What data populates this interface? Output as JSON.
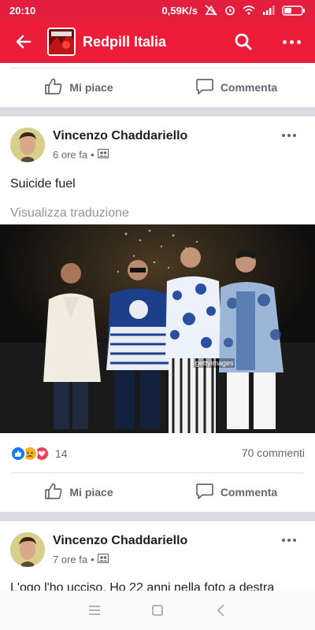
{
  "status_bar": {
    "time": "20:10",
    "speed": "0,59K/s",
    "icons": [
      "data-saver-icon",
      "alarm-icon",
      "wifi-icon",
      "signal-icon",
      "battery-icon"
    ]
  },
  "app_bar": {
    "title": "Redpill Italia",
    "icons": [
      "back-arrow-icon",
      "search-icon",
      "more-icon"
    ],
    "accent_color": "#ed1d3a"
  },
  "top_actions": {
    "like_label": "Mi piace",
    "comment_label": "Commenta"
  },
  "post1": {
    "author": "Vincenzo Chaddariello",
    "time": "6 ore fa",
    "separator": "•",
    "text": "Suicide fuel",
    "translate_label": "Visualizza traduzione",
    "reaction_icons": [
      "like-reaction-icon",
      "sad-reaction-icon",
      "love-reaction-icon"
    ],
    "reaction_count": "14",
    "comments_count": "70 commenti",
    "like_label": "Mi piace",
    "comment_label": "Commenta"
  },
  "post2": {
    "author": "Vincenzo Chaddariello",
    "time": "7 ore fa",
    "separator": "•",
    "text_partial": "L'ogo l'ho ucciso. Ho 22 anni nella foto a destra"
  },
  "nav_bar": {
    "icons": [
      "menu-icon",
      "home-icon",
      "back-icon"
    ]
  }
}
